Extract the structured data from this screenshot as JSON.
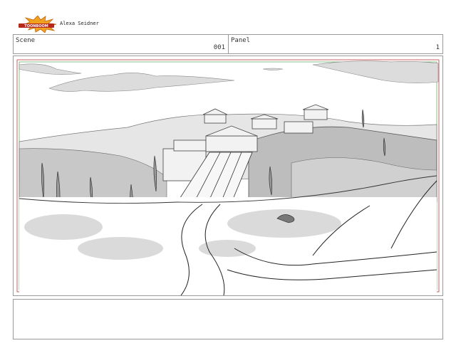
{
  "logo": {
    "icon": "toon-boom-logo",
    "text": "TOONBOOM"
  },
  "author": "Alexa Seidner",
  "scene": {
    "label": "Scene",
    "value": "001"
  },
  "panel": {
    "label": "Panel",
    "value": "1"
  },
  "notes": {
    "text": ""
  }
}
